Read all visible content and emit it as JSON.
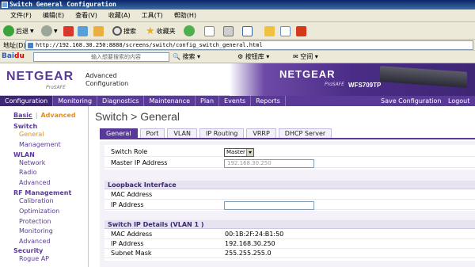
{
  "window": {
    "title": "Switch General Configuration"
  },
  "menu": [
    "文件(F)",
    "编辑(E)",
    "查看(V)",
    "收藏(A)",
    "工具(T)",
    "帮助(H)"
  ],
  "toolbar": {
    "back": "后退",
    "search": "搜索",
    "favorites": "收藏夹"
  },
  "address": {
    "label": "地址(D)",
    "url": "http://192.168.30.250:8888/screens/switch/config_switch_general.html"
  },
  "baidu": {
    "search_placeholder": "输入想要搜索的内容",
    "search_button": "搜索",
    "ie_button": "按钮库",
    "space": "空间"
  },
  "brand": {
    "logo": "NETGEAR",
    "prosafe": "ProSAFE",
    "title_line1": "Advanced",
    "title_line2": "Configuration",
    "model": "WFS709TP"
  },
  "mainnav": {
    "items": [
      "Configuration",
      "Monitoring",
      "Diagnostics",
      "Maintenance",
      "Plan",
      "Events",
      "Reports"
    ],
    "save": "Save Configuration",
    "logout": "Logout"
  },
  "leftnav": {
    "basic": "Basic",
    "sep": "|",
    "advanced": "Advanced",
    "sections": [
      {
        "title": "Switch",
        "items": [
          "General",
          "Management"
        ]
      },
      {
        "title": "WLAN",
        "items": [
          "Network",
          "Radio",
          "Advanced"
        ]
      },
      {
        "title": "RF Management",
        "items": [
          "Calibration",
          "Optimization",
          "Protection",
          "Monitoring",
          "Advanced"
        ]
      },
      {
        "title": "Security",
        "items": [
          "Rogue AP"
        ]
      }
    ]
  },
  "page": {
    "title": "Switch > General",
    "tabs": [
      "General",
      "Port",
      "VLAN",
      "IP Routing",
      "VRRP",
      "DHCP Server"
    ]
  },
  "form": {
    "switch_role_label": "Switch Role",
    "switch_role_value": "Master",
    "master_ip_label": "Master IP Address",
    "master_ip_value": "192.168.30.250",
    "loopback_title": "Loopback Interface",
    "lb_mac_label": "MAC Address",
    "lb_ip_label": "IP Address",
    "switchip_title": "Switch IP Details (VLAN 1 )",
    "sw_mac_label": "MAC Address",
    "sw_mac_value": "00:1B:2F:24:B1:50",
    "sw_ip_label": "IP Address",
    "sw_ip_value": "192.168.30.250",
    "sw_mask_label": "Subnet Mask",
    "sw_mask_value": "255.255.255.0"
  },
  "colors": {
    "brand_purple": "#5a3a98",
    "accent_orange": "#e09020"
  }
}
